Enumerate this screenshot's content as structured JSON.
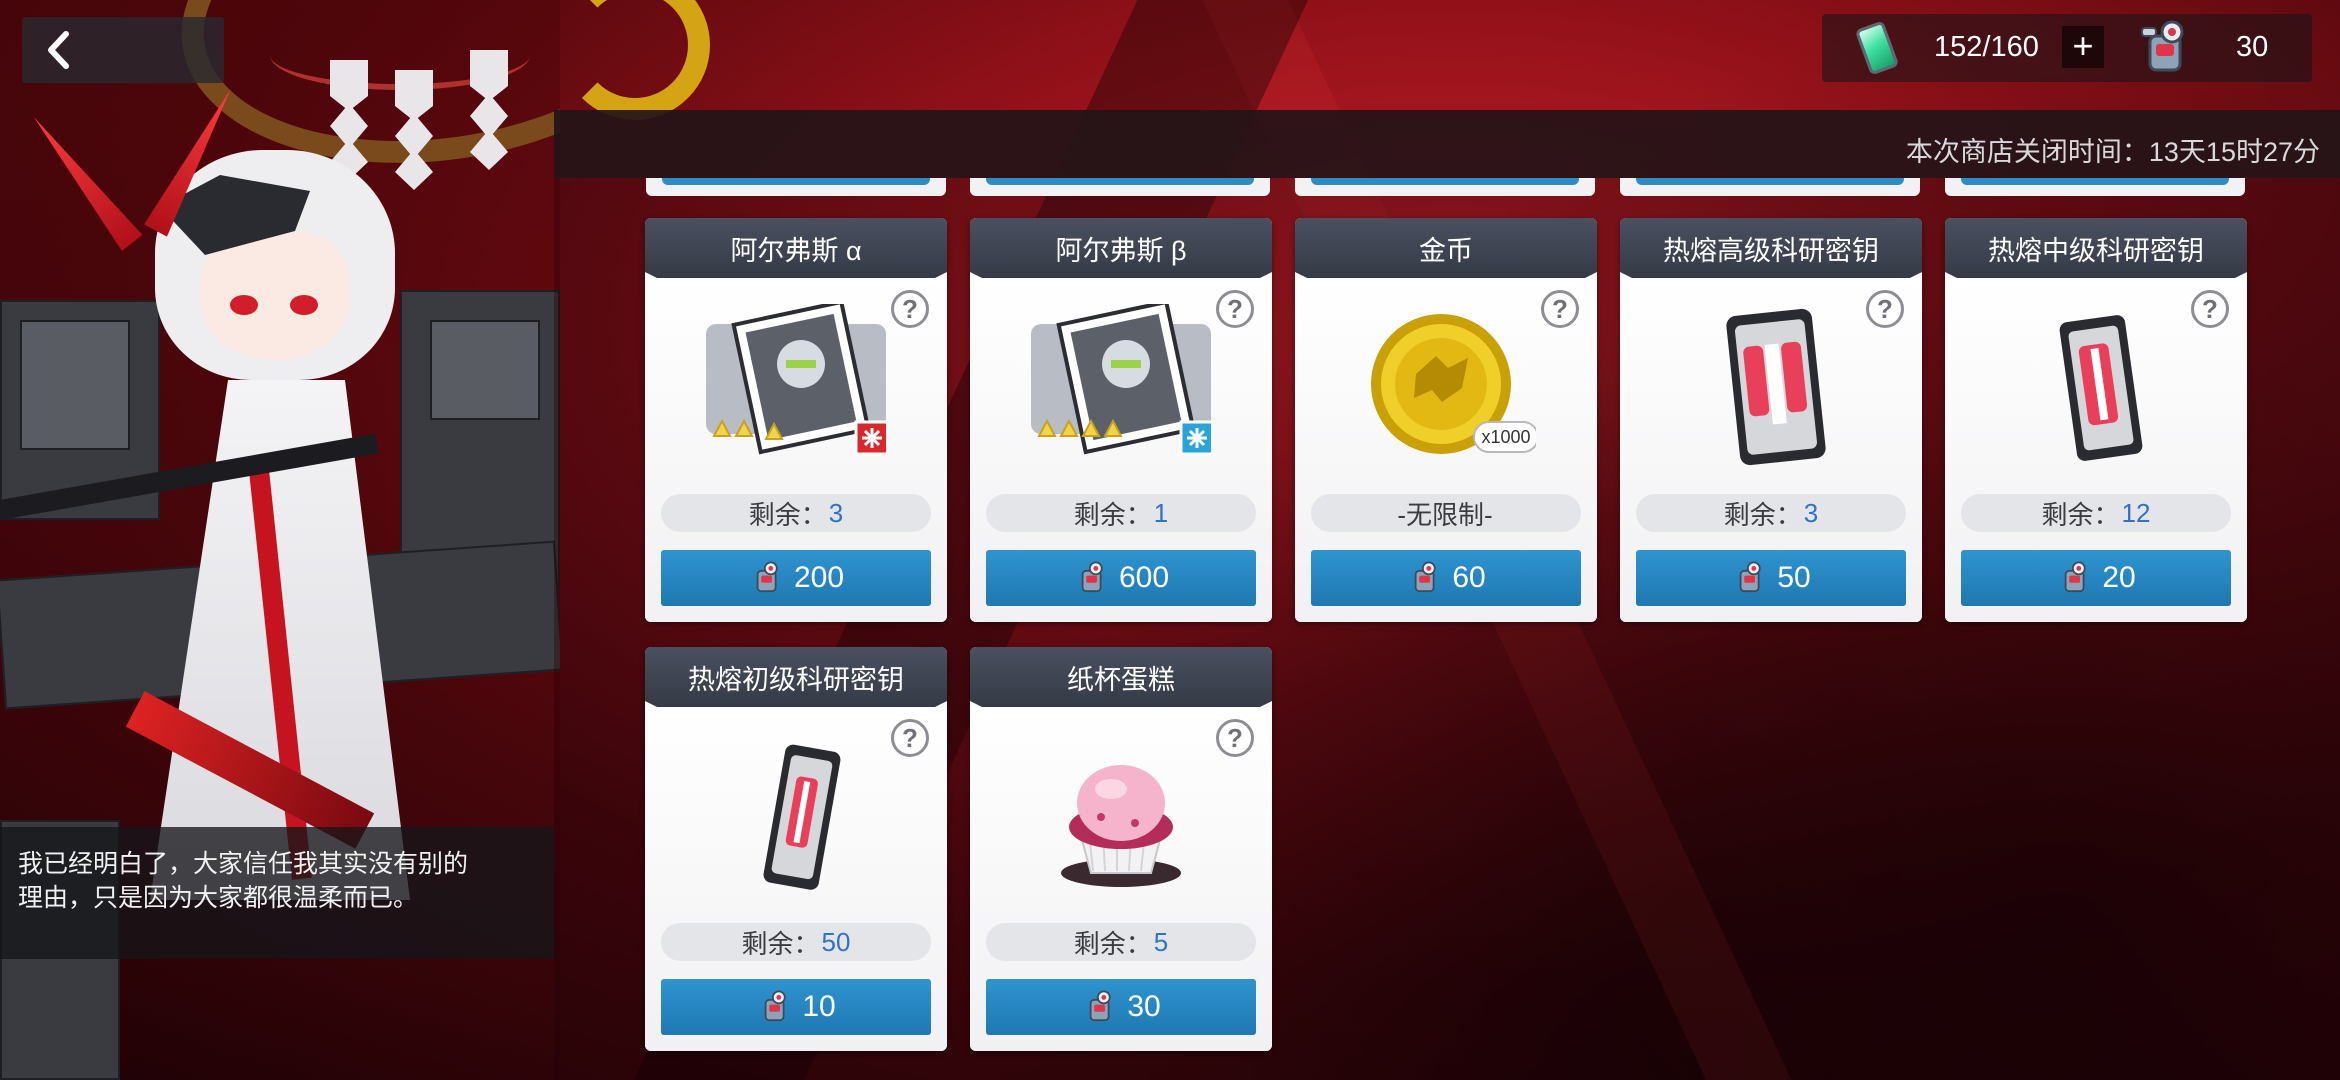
{
  "nav": {
    "back_icon": "chevron-left-icon"
  },
  "currency": {
    "energy_icon": "energy-battery-icon",
    "energy_value": "152/160",
    "plus_label": "+",
    "token_icon": "supply-token-icon",
    "token_value": "30"
  },
  "shop": {
    "close_time_label": "本次商店关闭时间：13天15时27分",
    "items": [
      {
        "name": "阿尔弗斯 α",
        "icon": "mech-card-icon",
        "remain_label": "剩余：",
        "remain_value": "3",
        "price": "200",
        "stars": 3,
        "element": "fire",
        "accent": "#d8282c"
      },
      {
        "name": "阿尔弗斯 β",
        "icon": "mech-card-icon",
        "remain_label": "剩余：",
        "remain_value": "1",
        "price": "600",
        "stars": 4,
        "element": "ice",
        "accent": "#2aa3d8"
      },
      {
        "name": "金币",
        "icon": "gold-coin-icon",
        "remain_label": "-无限制-",
        "remain_value": "",
        "price": "60",
        "badge": "x1000"
      },
      {
        "name": "热熔高级科研密钥",
        "icon": "research-key-icon",
        "remain_label": "剩余：",
        "remain_value": "3",
        "price": "50"
      },
      {
        "name": "热熔中级科研密钥",
        "icon": "research-key-icon",
        "remain_label": "剩余：",
        "remain_value": "12",
        "price": "20"
      },
      {
        "name": "热熔初级科研密钥",
        "icon": "research-key-icon",
        "remain_label": "剩余：",
        "remain_value": "50",
        "price": "10"
      },
      {
        "name": "纸杯蛋糕",
        "icon": "cupcake-icon",
        "remain_label": "剩余：",
        "remain_value": "5",
        "price": "30"
      }
    ],
    "help_label": "?"
  },
  "dialog": {
    "line1": "我已经明白了，大家信任我其实没有别的",
    "line2": "理由，只是因为大家都很温柔而已。"
  },
  "colors": {
    "price_button": "#2586c0",
    "remain_number": "#2f72c8"
  }
}
